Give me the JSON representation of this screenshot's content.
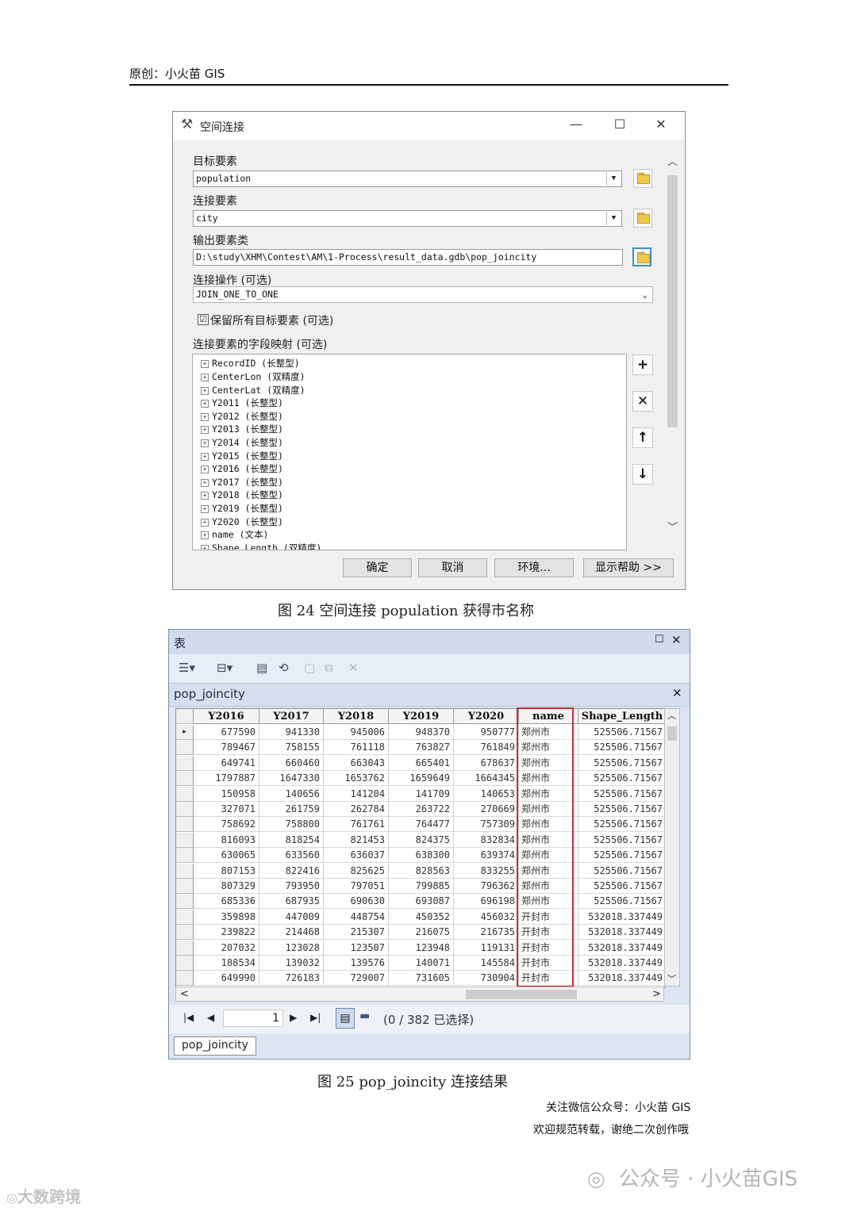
{
  "page": {
    "header": "原创：小火苗 GIS",
    "figure24_caption": "图 24  空间连接 population 获得市名称",
    "figure25_caption": "图 25 pop_joincity 连接结果",
    "footer_line1": "关注微信公众号：小火苗 GIS",
    "footer_line2": "欢迎规范转载，谢绝二次创作哦",
    "watermark_wechat": "公众号 · 小火苗GIS",
    "watermark_corner": "大数跨境"
  },
  "dialog": {
    "title": "空间连接",
    "target_label": "目标要素",
    "target_value": "population",
    "join_label": "连接要素",
    "join_value": "city",
    "output_label": "输出要素类",
    "output_value": "D:\\study\\XHM\\Contest\\AM\\1-Process\\result_data.gdb\\pop_joincity",
    "operation_label": "连接操作 (可选)",
    "operation_value": "JOIN_ONE_TO_ONE",
    "keep_all_label": "保留所有目标要素 (可选)",
    "keep_all_checked": "☑",
    "field_map_label": "连接要素的字段映射 (可选)",
    "fields": [
      "RecordID (长整型)",
      "CenterLon (双精度)",
      "CenterLat (双精度)",
      "Y2011 (长整型)",
      "Y2012 (长整型)",
      "Y2013 (长整型)",
      "Y2014 (长整型)",
      "Y2015 (长整型)",
      "Y2016 (长整型)",
      "Y2017 (长整型)",
      "Y2018 (长整型)",
      "Y2019 (长整型)",
      "Y2020 (长整型)",
      "name (文本)",
      "Shape_Length (双精度)"
    ],
    "buttons": {
      "ok": "确定",
      "cancel": "取消",
      "env": "环境...",
      "help": "显示帮助 >>"
    }
  },
  "table_window": {
    "title": "表",
    "tab_name": "pop_joincity",
    "columns": [
      "Y2016",
      "Y2017",
      "Y2018",
      "Y2019",
      "Y2020",
      "name",
      "Shape_Length"
    ],
    "rows": [
      [
        "677590",
        "941330",
        "945006",
        "948370",
        "950777",
        "郑州市",
        "525506.71567"
      ],
      [
        "789467",
        "758155",
        "761118",
        "763827",
        "761849",
        "郑州市",
        "525506.71567"
      ],
      [
        "649741",
        "660460",
        "663043",
        "665401",
        "678637",
        "郑州市",
        "525506.71567"
      ],
      [
        "1797887",
        "1647330",
        "1653762",
        "1659649",
        "1664345",
        "郑州市",
        "525506.71567"
      ],
      [
        "150958",
        "140656",
        "141204",
        "141709",
        "140653",
        "郑州市",
        "525506.71567"
      ],
      [
        "327071",
        "261759",
        "262784",
        "263722",
        "270669",
        "郑州市",
        "525506.71567"
      ],
      [
        "758692",
        "758800",
        "761761",
        "764477",
        "757309",
        "郑州市",
        "525506.71567"
      ],
      [
        "816093",
        "818254",
        "821453",
        "824375",
        "832834",
        "郑州市",
        "525506.71567"
      ],
      [
        "630065",
        "633560",
        "636037",
        "638300",
        "639374",
        "郑州市",
        "525506.71567"
      ],
      [
        "807153",
        "822416",
        "825625",
        "828563",
        "833255",
        "郑州市",
        "525506.71567"
      ],
      [
        "807329",
        "793950",
        "797051",
        "799885",
        "796362",
        "郑州市",
        "525506.71567"
      ],
      [
        "685336",
        "687935",
        "690630",
        "693087",
        "696198",
        "郑州市",
        "525506.71567"
      ],
      [
        "359898",
        "447009",
        "448754",
        "450352",
        "456032",
        "开封市",
        "532018.337449"
      ],
      [
        "239822",
        "214468",
        "215307",
        "216075",
        "216735",
        "开封市",
        "532018.337449"
      ],
      [
        "207032",
        "123028",
        "123507",
        "123948",
        "119131",
        "开封市",
        "532018.337449"
      ],
      [
        "188534",
        "139032",
        "139576",
        "140071",
        "145584",
        "开封市",
        "532018.337449"
      ],
      [
        "649990",
        "726183",
        "729007",
        "731605",
        "730904",
        "开封市",
        "532018.337449"
      ]
    ],
    "current_record": "1",
    "selection_status": "(0 / 382 已选择)",
    "bottom_tab": "pop_joincity"
  }
}
